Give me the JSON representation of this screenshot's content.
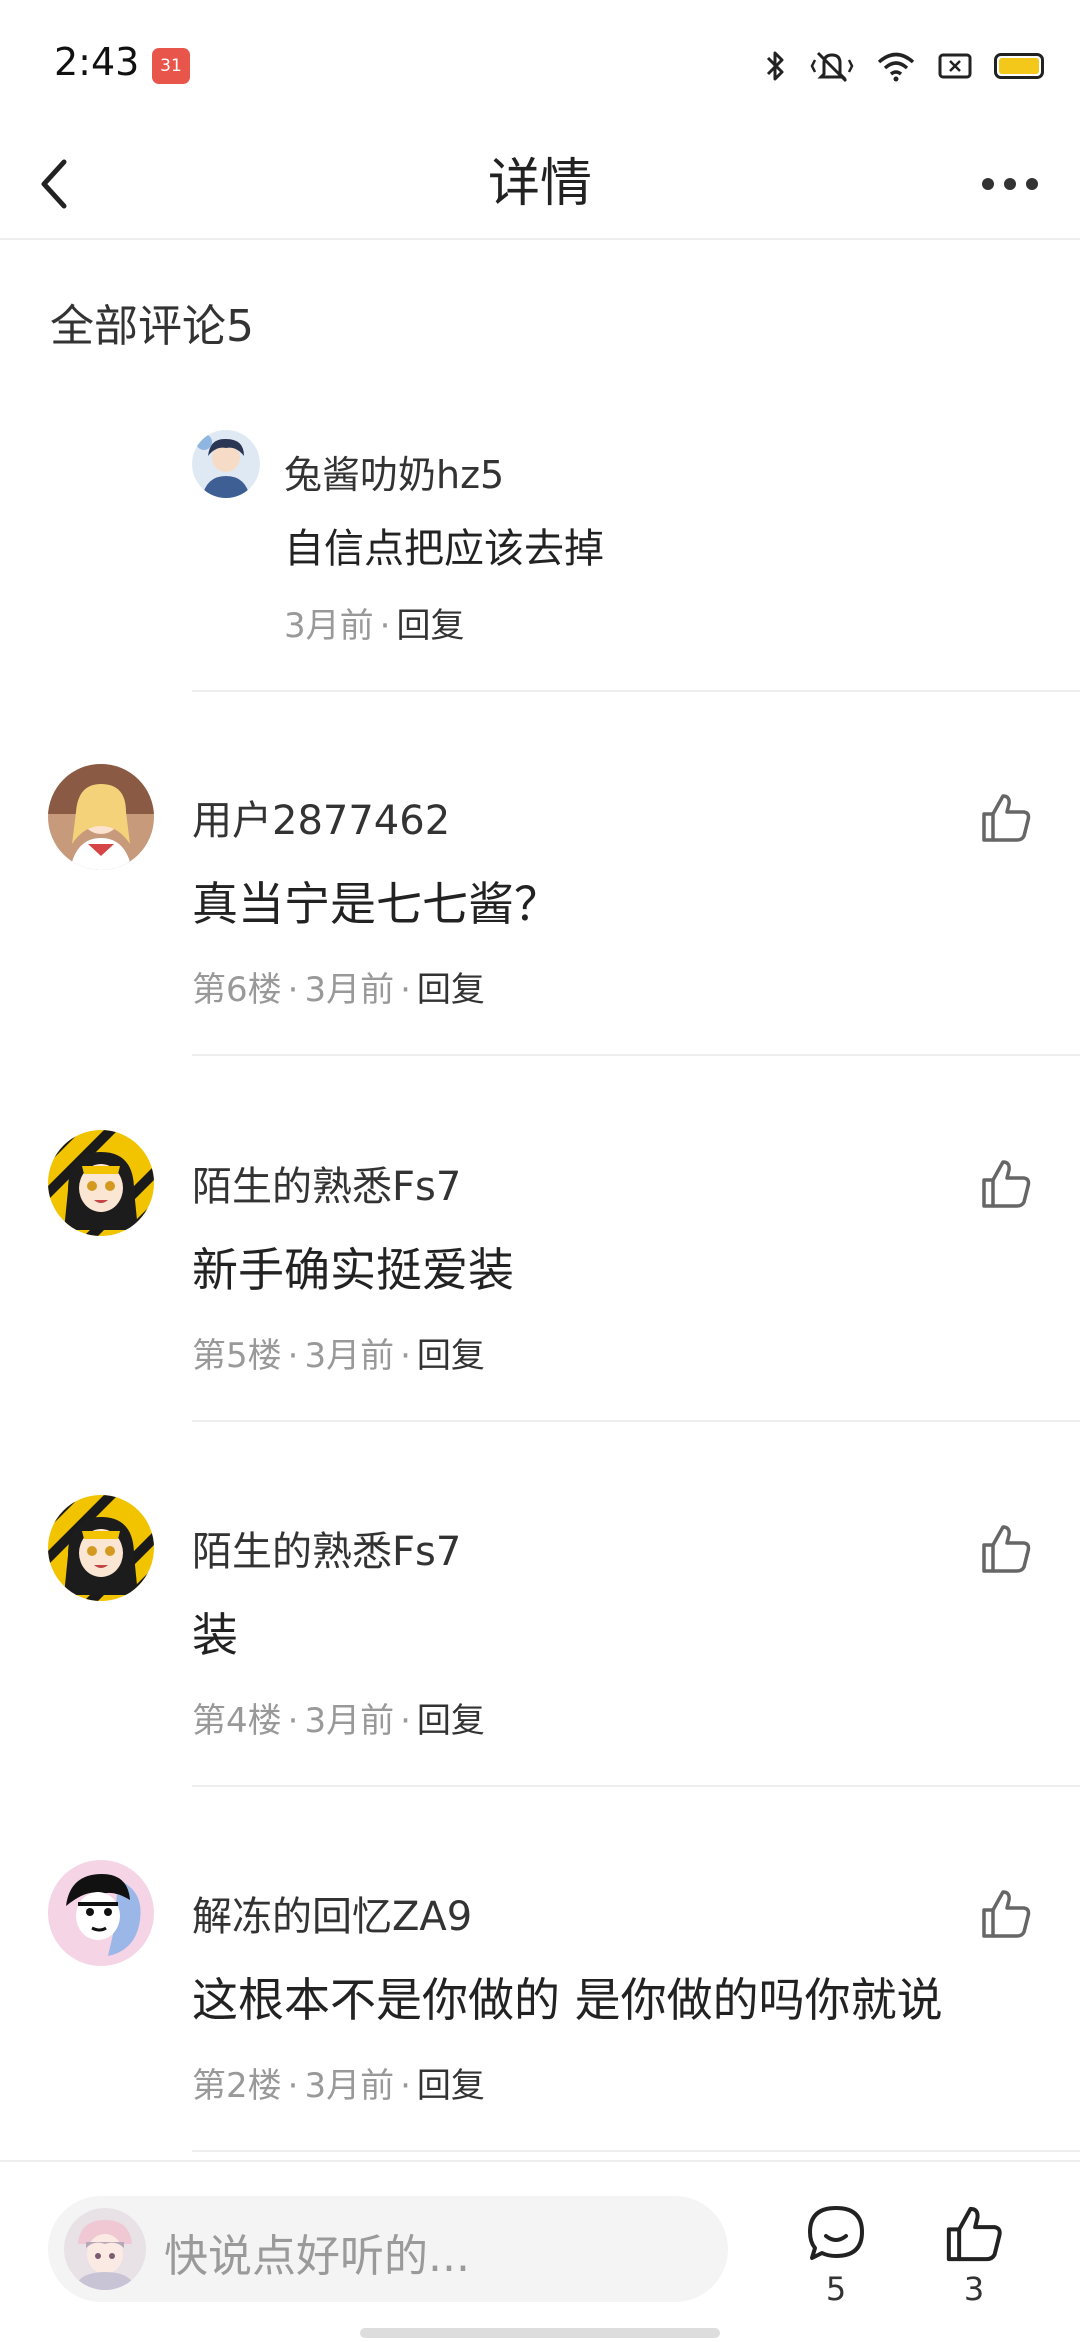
{
  "status_bar": {
    "time": "2:43",
    "calendar_badge": "31",
    "icons": [
      "bluetooth-icon",
      "mute-icon",
      "wifi-icon",
      "sim-icon",
      "battery-icon"
    ]
  },
  "header": {
    "title": "详情",
    "back_icon": "chevron-left-icon",
    "more_icon": "more-horizontal-icon"
  },
  "section_title": "全部评论5",
  "reply": {
    "author": "兔酱叻奶hz5",
    "text": "自信点把应该去掉",
    "time": "3月前",
    "reply_label": "回复"
  },
  "comments": [
    {
      "author": "用户2877462",
      "text": "真当宁是七七酱？",
      "floor": "第6楼",
      "time": "3月前",
      "reply_label": "回复"
    },
    {
      "author": "陌生的熟悉Fs7",
      "text": "新手确实挺爱装",
      "floor": "第5楼",
      "time": "3月前",
      "reply_label": "回复"
    },
    {
      "author": "陌生的熟悉Fs7",
      "text": "装",
      "floor": "第4楼",
      "time": "3月前",
      "reply_label": "回复"
    },
    {
      "author": "解冻的回忆ZA9",
      "text": "这根本不是你做的 是你做的吗你就说",
      "floor": "第2楼",
      "time": "3月前",
      "reply_label": "回复"
    }
  ],
  "separator": "·",
  "bottom_bar": {
    "input_placeholder": "快说点好听的...",
    "comment_count": "5",
    "like_count": "3"
  },
  "colors": {
    "accent_battery": "#f4c81b",
    "calendar_badge": "#e8554a",
    "meta_text": "#999999",
    "divider": "#eeeeee"
  }
}
